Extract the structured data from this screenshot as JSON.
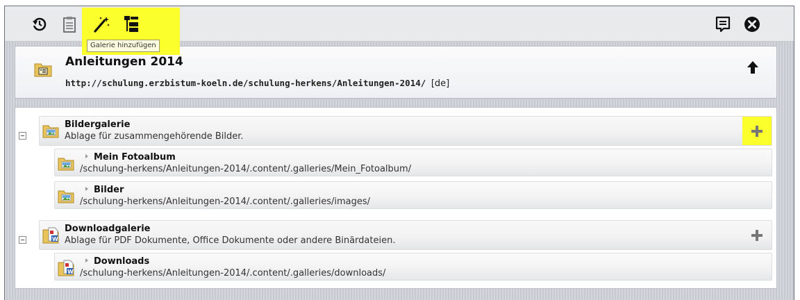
{
  "toolbar": {
    "tooltip": "Galerie hinzufügen",
    "highlight_color": "#fbff2b",
    "icons_left": [
      "history-icon",
      "clipboard-icon",
      "magic-wand-icon",
      "tree-icon"
    ],
    "icons_right": [
      "publish-list-icon",
      "close-icon"
    ]
  },
  "header": {
    "title": "Anleitungen 2014",
    "url": "http://schulung.erzbistum-koeln.de/schulung-herkens/Anleitungen-2014/",
    "locale": "[de]"
  },
  "galleries": [
    {
      "title": "Bildergalerie",
      "description": "Ablage für zusammengehörende Bilder.",
      "icon": "image-folder-icon",
      "add_highlighted": true,
      "items": [
        {
          "title": "Mein Fotoalbum",
          "path": "/schulung-herkens/Anleitungen-2014/.content/.galleries/Mein_Fotoalbum/"
        },
        {
          "title": "Bilder",
          "path": "/schulung-herkens/Anleitungen-2014/.content/.galleries/images/"
        }
      ]
    },
    {
      "title": "Downloadgalerie",
      "description": "Ablage für PDF Dokumente, Office Dokumente oder andere Binärdateien.",
      "icon": "download-folder-icon",
      "add_highlighted": false,
      "items": [
        {
          "title": "Downloads",
          "path": "/schulung-herkens/Anleitungen-2014/.content/.galleries/downloads/"
        }
      ]
    }
  ]
}
